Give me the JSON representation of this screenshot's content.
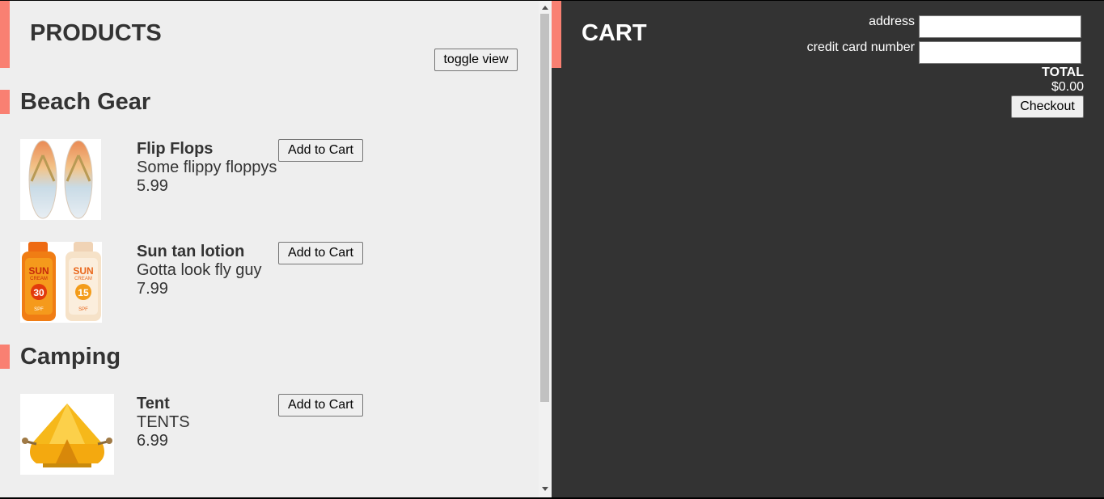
{
  "products": {
    "title": "PRODUCTS",
    "toggle_label": "toggle view",
    "categories": [
      {
        "name": "Beach Gear",
        "items": [
          {
            "name": "Flip Flops",
            "description": "Some flippy floppys",
            "price": "5.99",
            "button": "Add to Cart"
          },
          {
            "name": "Sun tan lotion",
            "description": "Gotta look fly guy",
            "price": "7.99",
            "button": "Add to Cart"
          }
        ]
      },
      {
        "name": "Camping",
        "items": [
          {
            "name": "Tent",
            "description": "TENTS",
            "price": "6.99",
            "button": "Add to Cart"
          }
        ]
      }
    ]
  },
  "cart": {
    "title": "CART",
    "address_label": "address",
    "address_value": "",
    "card_label": "credit card number",
    "card_value": "",
    "total_label": "TOTAL",
    "total_value": "$0.00",
    "checkout_label": "Checkout"
  },
  "lotion_labels": {
    "left_brand": "SUN",
    "left_sub": "CREAM",
    "left_spf": "30",
    "left_tag": "SPF",
    "right_brand": "SUN",
    "right_sub": "CREAM",
    "right_spf": "15",
    "right_tag": "SPF"
  },
  "colors": {
    "accent": "#f98072",
    "products_bg": "#eeeeee",
    "cart_bg": "#333333"
  }
}
